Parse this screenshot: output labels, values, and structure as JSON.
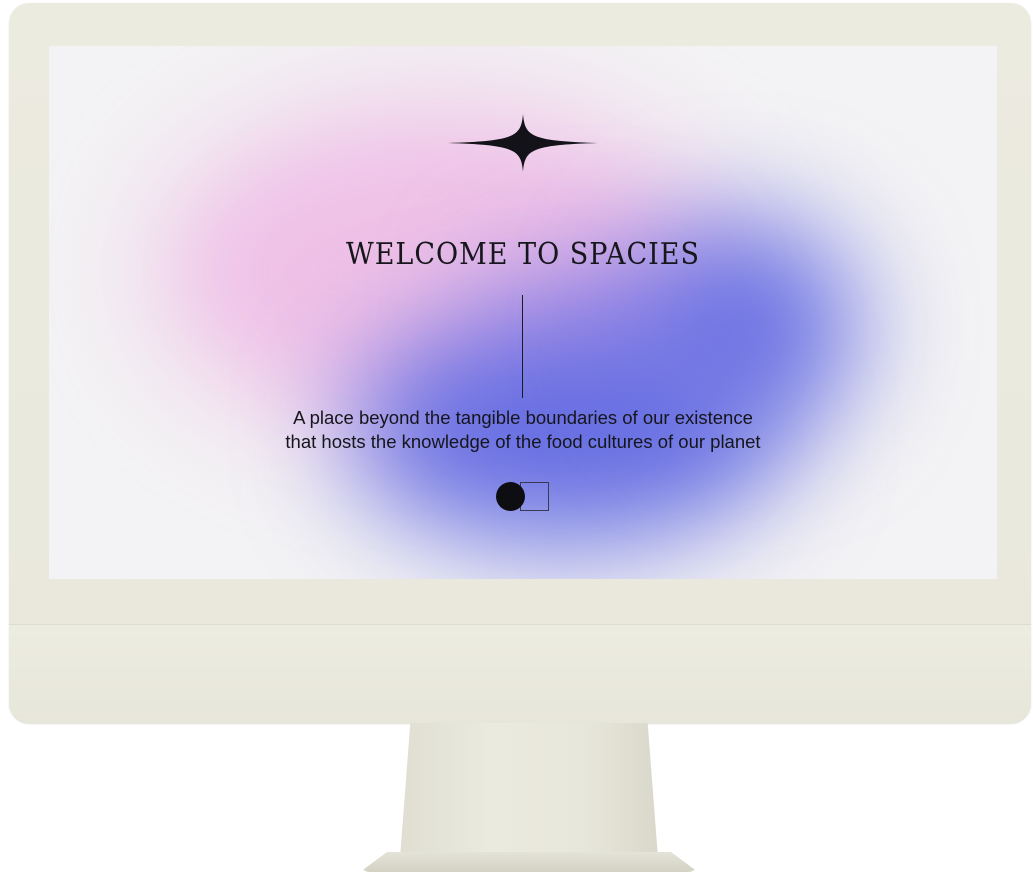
{
  "hero": {
    "title": "WELCOME TO SPACIES",
    "subtitle_line1": "A place beyond the tangible boundaries of our existence",
    "subtitle_line2": "that hosts the knowledge of the food cultures of our planet"
  },
  "icons": {
    "sparkle": "four-point-star-icon",
    "toggle": "circle-square-toggle"
  },
  "colors": {
    "background": "#f3f2f4",
    "pink_glow": "#eebae6",
    "blue_glow": "#5c66e2",
    "text": "#16161c",
    "monitor_frame": "#ecebe0"
  }
}
